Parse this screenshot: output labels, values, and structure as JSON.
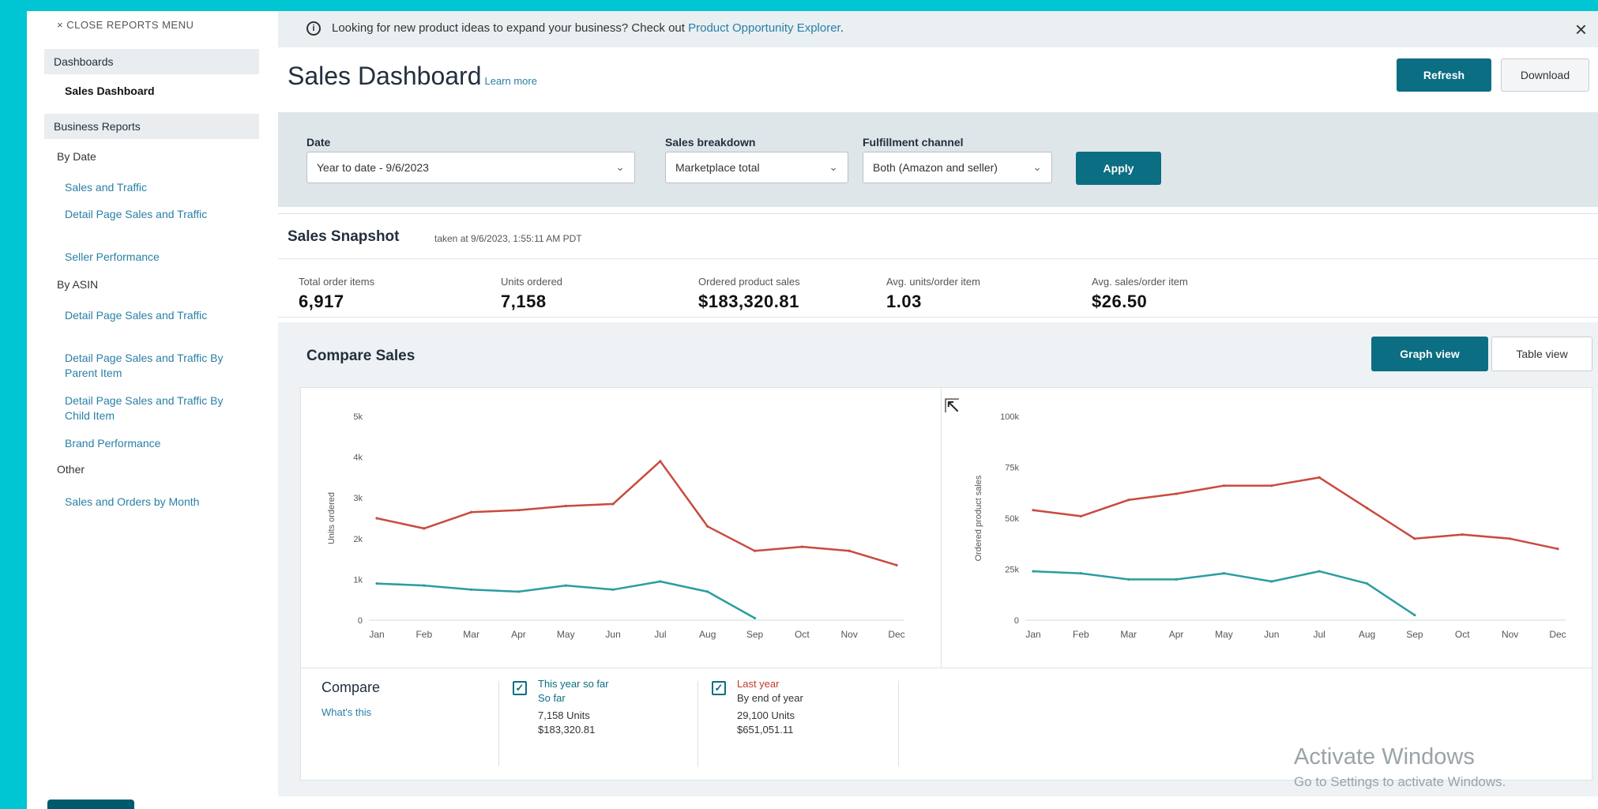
{
  "sidebar": {
    "close_label": "× CLOSE REPORTS MENU",
    "dashboards_label": "Dashboards",
    "sales_dashboard_label": "Sales Dashboard",
    "business_reports_label": "Business Reports",
    "by_date_label": "By Date",
    "by_date_items": [
      "Sales and Traffic",
      "Detail Page Sales and Traffic",
      "Seller Performance"
    ],
    "by_asin_label": "By ASIN",
    "by_asin_items": [
      "Detail Page Sales and Traffic",
      "Detail Page Sales and Traffic By Parent Item",
      "Detail Page Sales and Traffic By Child Item",
      "Brand Performance"
    ],
    "other_label": "Other",
    "other_items": [
      "Sales and Orders by Month"
    ]
  },
  "banner": {
    "info_icon": "i",
    "text": "Looking for new product ideas to expand your business? Check out ",
    "link": "Product Opportunity Explorer",
    "link_suffix": ".",
    "close": "×"
  },
  "header": {
    "title": "Sales Dashboard",
    "learn_more": "Learn more",
    "refresh_label": "Refresh",
    "download_label": "Download"
  },
  "filters": {
    "date_label": "Date",
    "date_value": "Year to date - 9/6/2023",
    "breakdown_label": "Sales breakdown",
    "breakdown_value": "Marketplace total",
    "channel_label": "Fulfillment channel",
    "channel_value": "Both (Amazon and seller)",
    "apply_label": "Apply",
    "chevron": "⌄"
  },
  "snapshot": {
    "title": "Sales Snapshot",
    "taken": "taken at 9/6/2023, 1:55:11 AM PDT",
    "metrics": [
      {
        "label": "Total order items",
        "value": "6,917"
      },
      {
        "label": "Units ordered",
        "value": "7,158"
      },
      {
        "label": "Ordered product sales",
        "value": "$183,320.81"
      },
      {
        "label": "Avg. units/order item",
        "value": "1.03"
      },
      {
        "label": "Avg. sales/order item",
        "value": "$26.50"
      }
    ]
  },
  "compare": {
    "title": "Compare Sales",
    "graph_view_label": "Graph view",
    "table_view_label": "Table view",
    "legend_heading": "Compare",
    "whats_this": "What's this",
    "this_year": {
      "check": "✓",
      "label": "This year so far",
      "sub": "So far",
      "units": "7,158 Units",
      "sales": "$183,320.81"
    },
    "last_year": {
      "check": "✓",
      "label": "Last year",
      "sub": "By end of year",
      "units": "29,100 Units",
      "sales": "$651,051.11"
    }
  },
  "colors": {
    "teal": "#2a9d9f",
    "red": "#c94a3f",
    "accent": "#0b6e82"
  },
  "chart_data": [
    {
      "type": "line",
      "ylabel": "Units ordered",
      "categories": [
        "Jan",
        "Feb",
        "Mar",
        "Apr",
        "May",
        "Jun",
        "Jul",
        "Aug",
        "Sep",
        "Oct",
        "Nov",
        "Dec"
      ],
      "yticks": [
        "0",
        "1k",
        "2k",
        "3k",
        "4k",
        "5k"
      ],
      "ylim": [
        0,
        5000
      ],
      "series": [
        {
          "name": "Last year",
          "color": "#c94a3f",
          "values": [
            2500,
            2250,
            2650,
            2700,
            2800,
            2850,
            3900,
            2300,
            1700,
            1800,
            1700,
            1350
          ]
        },
        {
          "name": "This year so far",
          "color": "#2a9d9f",
          "values": [
            900,
            850,
            750,
            700,
            850,
            750,
            950,
            700,
            50
          ]
        }
      ]
    },
    {
      "type": "line",
      "ylabel": "Ordered product sales",
      "categories": [
        "Jan",
        "Feb",
        "Mar",
        "Apr",
        "May",
        "Jun",
        "Jul",
        "Aug",
        "Sep",
        "Oct",
        "Nov",
        "Dec"
      ],
      "yticks": [
        "0",
        "25k",
        "50k",
        "75k",
        "100k"
      ],
      "ylim": [
        0,
        100000
      ],
      "series": [
        {
          "name": "Last year",
          "color": "#c94a3f",
          "values": [
            54000,
            51000,
            59000,
            62000,
            66000,
            66000,
            70000,
            55000,
            40000,
            42000,
            40000,
            35000
          ]
        },
        {
          "name": "This year so far",
          "color": "#2a9d9f",
          "values": [
            24000,
            23000,
            20000,
            20000,
            23000,
            19000,
            24000,
            18000,
            2500
          ]
        }
      ]
    }
  ],
  "watermark": {
    "line1": "Activate Windows",
    "line2": "Go to Settings to activate Windows."
  }
}
